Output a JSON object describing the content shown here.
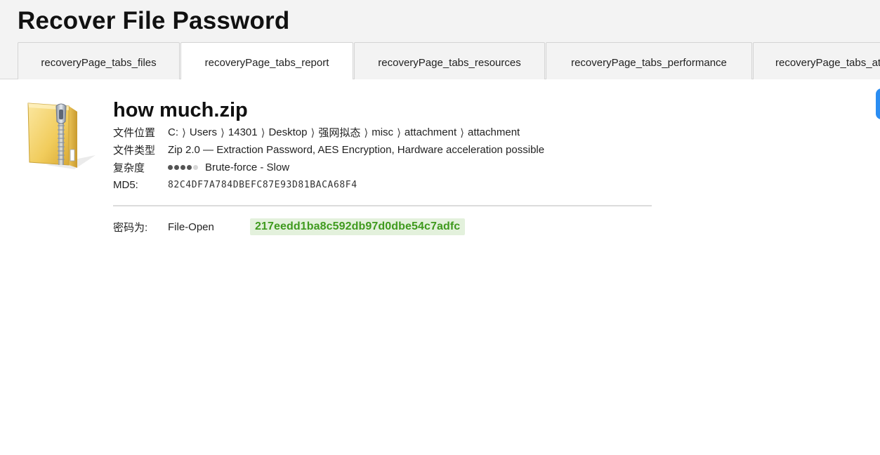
{
  "header": {
    "title": "Recover File Password"
  },
  "tabs": [
    {
      "label": "recoveryPage_tabs_files",
      "active": false
    },
    {
      "label": "recoveryPage_tabs_report",
      "active": true
    },
    {
      "label": "recoveryPage_tabs_resources",
      "active": false
    },
    {
      "label": "recoveryPage_tabs_performance",
      "active": false
    },
    {
      "label": "recoveryPage_tabs_at",
      "active": false
    }
  ],
  "file": {
    "icon": "zip-folder-icon",
    "name": "how much.zip",
    "location_label": "文件位置",
    "location_path": [
      "C:",
      "Users",
      "14301",
      "Desktop",
      "强网拟态",
      "misc",
      "attachment",
      "attachment"
    ],
    "path_separator": "⟩",
    "type_label": "文件类型",
    "type_value": "Zip 2.0 — Extraction Password, AES Encryption, Hardware acceleration possible",
    "complexity_label": "复杂度",
    "complexity_level": 4,
    "complexity_max": 5,
    "complexity_text": "Brute-force - Slow",
    "md5_label": "MD5:",
    "md5_value": "82C4DF7A784DBEFC87E93D81BACA68F4"
  },
  "result": {
    "password_label": "密码为:",
    "password_type": "File-Open",
    "password_value": "217eedd1ba8c592db97d0dbe54c7adfc"
  },
  "colors": {
    "accent": "#2a8df2",
    "password_text": "#3f9a1e",
    "password_bg": "#e3f1dc"
  }
}
